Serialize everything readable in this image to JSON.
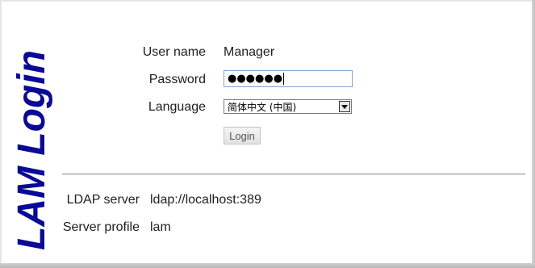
{
  "logo": {
    "text": "LAM  Login"
  },
  "login_form": {
    "username_label": "User name",
    "username_value": "Manager",
    "password_label": "Password",
    "password_masked": "●●●●●●",
    "language_label": "Language",
    "language_selected": "简体中文 (中国)",
    "login_button_label": "Login"
  },
  "server_info": {
    "ldap_label": "LDAP server",
    "ldap_value": "ldap://localhost:389",
    "profile_label": "Server profile",
    "profile_value": "lam"
  },
  "colors": {
    "logo": "#0a0a96",
    "input_focus_border": "#7ea6cc"
  }
}
